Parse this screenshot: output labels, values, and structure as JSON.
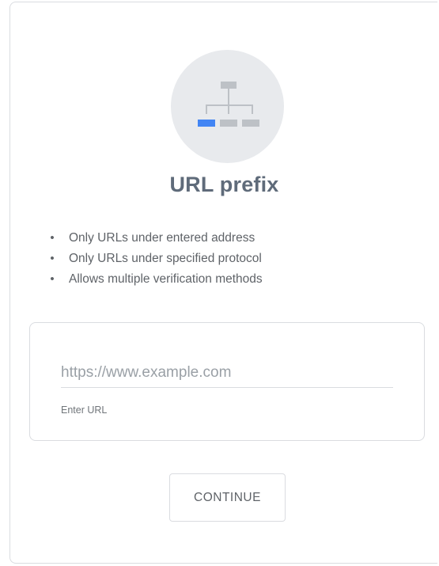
{
  "card": {
    "title": "URL prefix",
    "icon": "sitemap-icon",
    "features": [
      "Only URLs under entered address",
      "Only URLs under specified protocol",
      "Allows multiple verification methods"
    ],
    "url_field": {
      "placeholder": "https://www.example.com",
      "value": "",
      "hint": "Enter URL"
    },
    "continue_label": "CONTINUE"
  },
  "colors": {
    "icon_circle": "#e8eaed",
    "icon_accent": "#4285f4",
    "icon_gray": "#bdc1c6",
    "title": "#5f6b7a"
  }
}
